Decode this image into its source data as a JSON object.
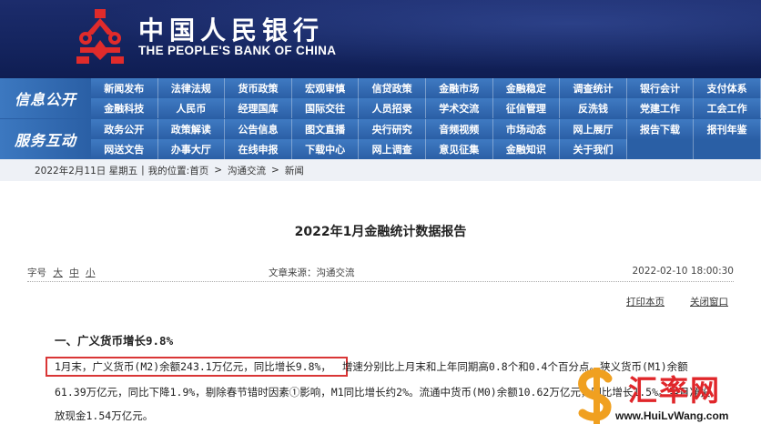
{
  "header": {
    "bank_name_cn": "中国人民银行",
    "bank_name_en": "THE PEOPLE'S BANK OF CHINA",
    "colors": {
      "background": "#14245e",
      "emblem": "#e02b2b"
    }
  },
  "nav": {
    "side_labels": [
      "信息公开",
      "服务互动"
    ],
    "rows": [
      [
        "新闻发布",
        "法律法规",
        "货币政策",
        "宏观审慎",
        "信贷政策",
        "金融市场",
        "金融稳定",
        "调查统计",
        "银行会计",
        "支付体系"
      ],
      [
        "金融科技",
        "人民币",
        "经理国库",
        "国际交往",
        "人员招录",
        "学术交流",
        "征信管理",
        "反洗钱",
        "党建工作",
        "工会工作"
      ],
      [
        "政务公开",
        "政策解读",
        "公告信息",
        "图文直播",
        "央行研究",
        "音频视频",
        "市场动态",
        "网上展厅",
        "报告下载",
        "报刊年鉴"
      ],
      [
        "网送文告",
        "办事大厅",
        "在线申报",
        "下载中心",
        "网上调查",
        "意见征集",
        "金融知识",
        "关于我们",
        "",
        ""
      ]
    ]
  },
  "breadcrumb": {
    "date": "2022年2月11日 星期五",
    "location_label": "我的位置:",
    "items": [
      "首页",
      "沟通交流",
      "新闻"
    ],
    "separator": ">"
  },
  "article": {
    "title": "2022年1月金融统计数据报告",
    "font_size_label": "字号",
    "font_sizes": [
      "大",
      "中",
      "小"
    ],
    "source": "文章来源：沟通交流",
    "datetime": "2022-02-10 18:00:30",
    "print_label": "打印本页",
    "close_label": "关闭窗口",
    "section_title": "一、广义货币增长9.8%",
    "paragraph": {
      "highlighted": "1月末，广义货币(M2)余额243.1万亿元，同比增长9.8%，",
      "line1_rest": "增速分别比上月末和上年同期高0.8个和0.4个百分点。狭义货币(M1)余额",
      "line2": "61.39万亿元，同比下降1.9%，剔除春节错时因素①影响，M1同比增长约2%。流通中货币(M0)余额10.62万亿元，同比增长1.5%。当月净投",
      "line3": "放现金1.54万亿元。"
    },
    "highlight_color": "#d93636"
  },
  "watermark": {
    "text": "汇率网",
    "url": "www.HuiLvWang.com",
    "color": "#e0262a"
  }
}
